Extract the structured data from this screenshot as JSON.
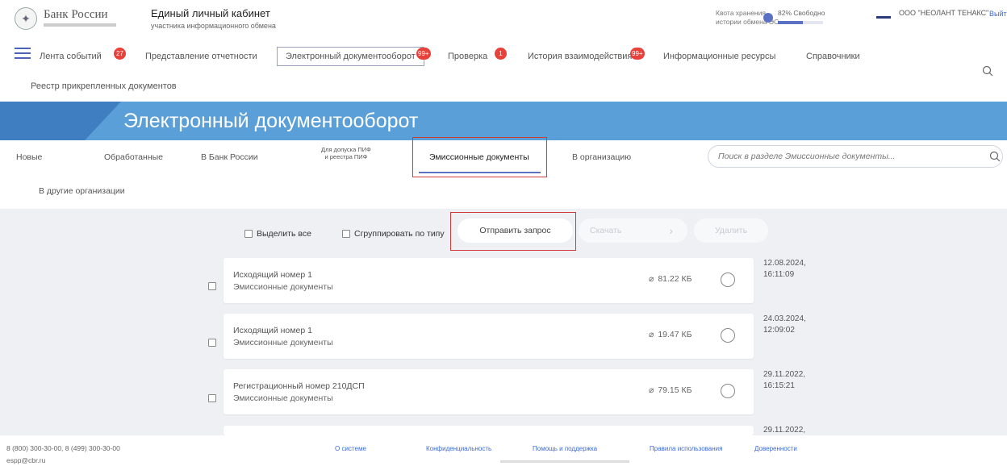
{
  "header": {
    "bank_name": "Банк России",
    "cabinet_title": "Единый личный кабинет",
    "cabinet_subtitle": "участника информационного обмена",
    "quota_label_1": "Квота хранения",
    "quota_label_2": "истории обмена ЭС",
    "quota_free": "82% Свободно",
    "quota_used_fraction": 0.55,
    "org_name": "ООО \"НЕОЛАНТ ТЕНАКС\"",
    "logout": "Выйти"
  },
  "nav": {
    "items": [
      {
        "label": "Лента событий",
        "badge": "27"
      },
      {
        "label": "Представление отчетности",
        "badge": ""
      },
      {
        "label": "Электронный документооборот",
        "badge": "99+"
      },
      {
        "label": "Проверка",
        "badge": "1"
      },
      {
        "label": "История взаимодействия",
        "badge": "99+"
      },
      {
        "label": "Информационные ресурсы",
        "badge": ""
      },
      {
        "label": "Справочники",
        "badge": ""
      }
    ],
    "registry": "Реестр прикрепленных документов"
  },
  "banner": {
    "title": "Электронный документооборот"
  },
  "tabs": {
    "items": [
      "Новые",
      "Обработанные",
      "В Банк России",
      "Для допуска ПИФ",
      "и реестра ПИФ",
      "Эмиссионные документы",
      "В организацию"
    ],
    "second_row": "В другие организации",
    "search_placeholder": "Поиск в разделе Эмиссионные документы..."
  },
  "toolbar": {
    "select_all": "Выделить все",
    "group_by_type": "Сгруппировать по типу",
    "send_request": "Отправить запрос",
    "download": "Скачать",
    "next": "›",
    "delete": "Удалить"
  },
  "documents": [
    {
      "title": "Исходящий номер 1",
      "type": "Эмиссионные документы",
      "size": "81.22 КБ",
      "date": "12.08.2024,",
      "time": "16:11:09"
    },
    {
      "title": "Исходящий номер 1",
      "type": "Эмиссионные документы",
      "size": "19.47 КБ",
      "date": "24.03.2024,",
      "time": "12:09:02"
    },
    {
      "title": "Регистрационный номер 210ДСП",
      "type": "Эмиссионные документы",
      "size": "79.15 КБ",
      "date": "29.11.2022,",
      "time": "16:15:21"
    },
    {
      "date": "29.11.2022,"
    }
  ],
  "footer": {
    "phones": "8 (800) 300-30-00, 8 (499) 300-30-00",
    "email": "espp@cbr.ru",
    "links": [
      "О системе",
      "Конфиденциальность",
      "Помощь и поддержка",
      "Правила использования",
      "Доверенности"
    ]
  },
  "colors": {
    "accent": "#5b72c4",
    "banner": "#5b9fd8",
    "badge": "#e8413a",
    "highlight": "#d23a3a"
  }
}
